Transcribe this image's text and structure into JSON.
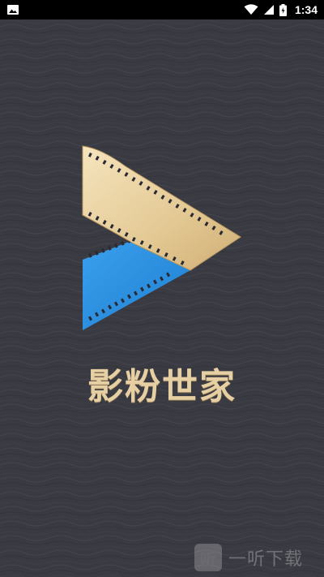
{
  "status_bar": {
    "time": "1:34",
    "left_icon": "image-icon",
    "icons": [
      "wifi-icon",
      "signal-icon",
      "battery-icon"
    ]
  },
  "splash": {
    "app_name": "影粉世家"
  },
  "watermark": {
    "icon_glyph": "听",
    "text": "一听下载"
  },
  "colors": {
    "background": "#3a3a42",
    "gold": "#e7cfa4",
    "blue": "#2b8fe0"
  }
}
